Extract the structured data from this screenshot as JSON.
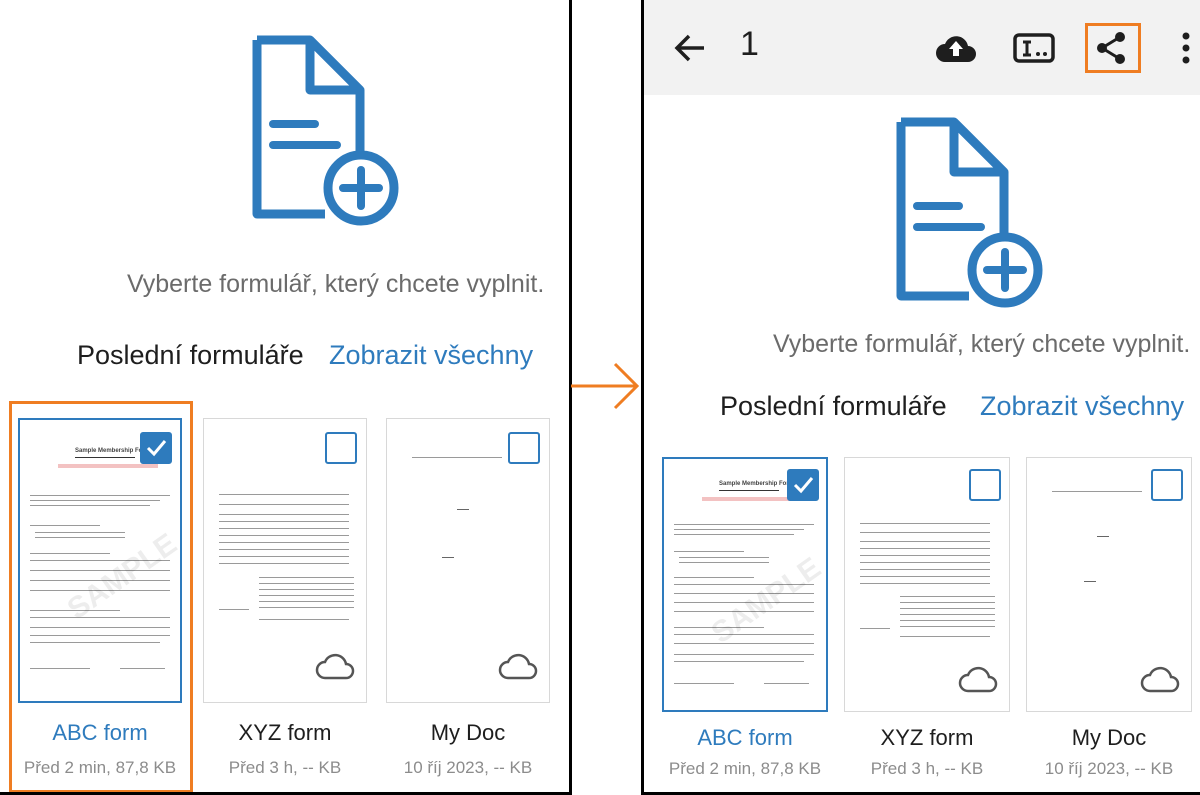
{
  "left": {
    "prompt": "Vyberte formulář, který chcete vyplnit.",
    "section_title": "Poslední formuláře",
    "view_all": "Zobrazit všechny",
    "cards": [
      {
        "title": "ABC form",
        "meta": "Před 2 min, 87,8 KB",
        "selected": true
      },
      {
        "title": "XYZ form",
        "meta": "Před 3 h, -- KB",
        "selected": false
      },
      {
        "title": "My Doc",
        "meta": "10 říj 2023, -- KB",
        "selected": false
      }
    ]
  },
  "right": {
    "toolbar": {
      "page_number": "1",
      "icons": [
        "back-arrow-icon",
        "cloud-upload-icon",
        "text-field-icon",
        "share-icon",
        "more-vert-icon"
      ]
    },
    "prompt": "Vyberte formulář, který chcete vyplnit.",
    "section_title": "Poslední formuláře",
    "view_all": "Zobrazit všechny",
    "cards": [
      {
        "title": "ABC form",
        "meta": "Před 2 min, 87,8 KB",
        "selected": true
      },
      {
        "title": "XYZ form",
        "meta": "Před 3 h, -- KB",
        "selected": false
      },
      {
        "title": "My Doc",
        "meta": "10 říj 2023, -- KB",
        "selected": false
      }
    ]
  },
  "thumbnail_text": {
    "abc_form_heading": "Sample Membership Form",
    "abc_form_watermark": "SAMPLE"
  },
  "colors": {
    "accent": "#2e7bbd",
    "highlight": "#ef7d22",
    "toolbar_bg": "#f2f2f2",
    "muted_text": "#8c8c8c"
  }
}
